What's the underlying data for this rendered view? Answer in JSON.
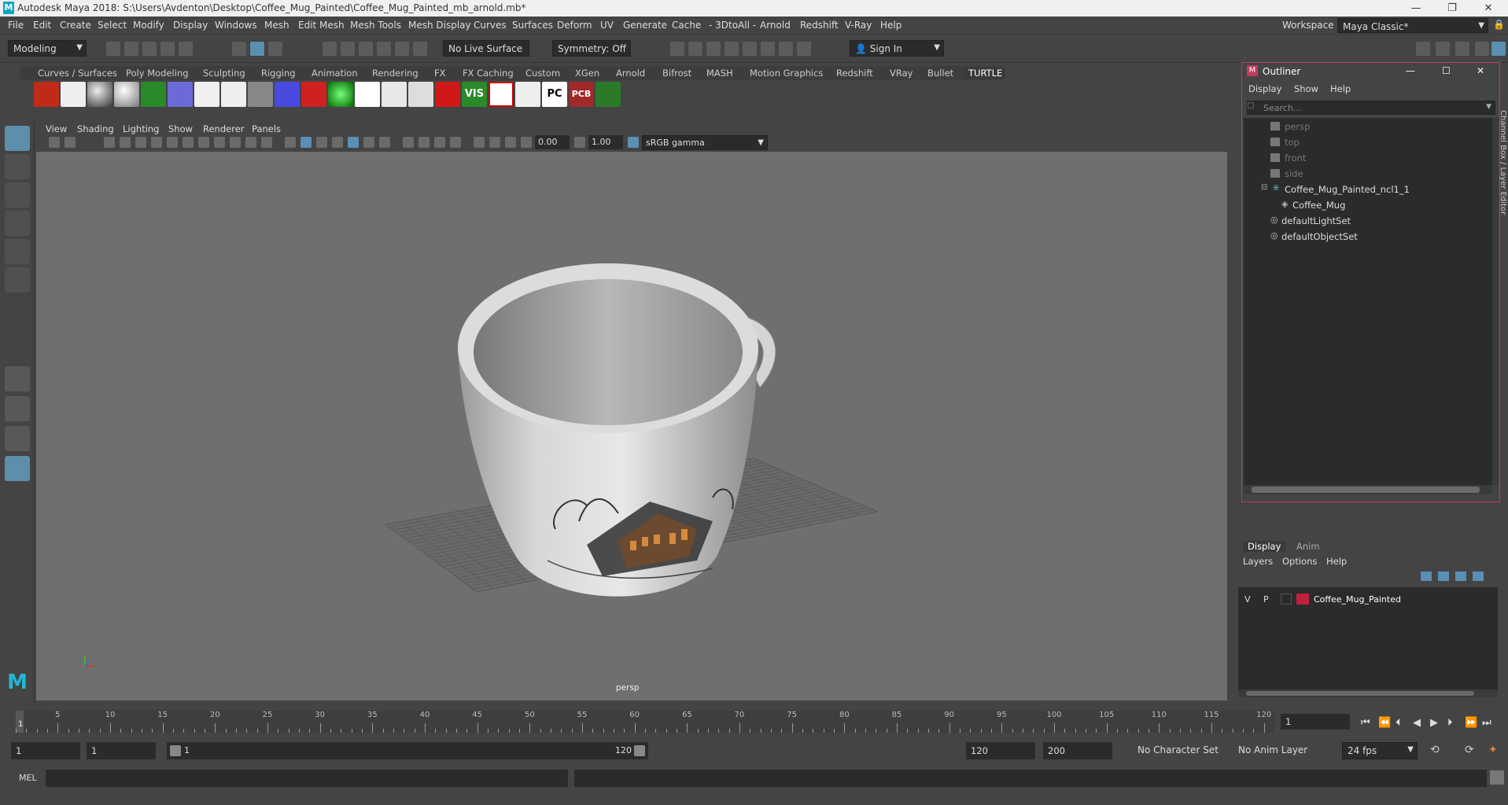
{
  "window": {
    "title": "Autodesk Maya 2018: S:\\Users\\Avdenton\\Desktop\\Coffee_Mug_Painted\\Coffee_Mug_Painted_mb_arnold.mb*",
    "minimize": "—",
    "restore": "❐",
    "close": "✕"
  },
  "menubar": [
    "File",
    "Edit",
    "Create",
    "Select",
    "Modify",
    "Display",
    "Windows",
    "Mesh",
    "Edit Mesh",
    "Mesh Tools",
    "Mesh Display",
    "Curves",
    "Surfaces",
    "Deform",
    "UV",
    "Generate",
    "Cache",
    "- 3DtoAll -",
    "Arnold",
    "Redshift",
    "V-Ray",
    "Help"
  ],
  "workspace": {
    "label": "Workspace :",
    "value": "Maya Classic*"
  },
  "statusline": {
    "mode": "Modeling",
    "live_surface": "No Live Surface",
    "symmetry": "Symmetry: Off",
    "sign_in": "Sign In"
  },
  "shelf": {
    "tabs": [
      "Curves / Surfaces",
      "Poly Modeling",
      "Sculpting",
      "Rigging",
      "Animation",
      "Rendering",
      "FX",
      "FX Caching",
      "Custom",
      "XGen",
      "Arnold",
      "Bifrost",
      "MASH",
      "Motion Graphics",
      "Redshift",
      "VRay",
      "Bullet",
      "TURTLE"
    ],
    "active_tab": "TURTLE",
    "icon_labels": [
      "VIS",
      "PC",
      "PCB"
    ]
  },
  "panel": {
    "menu": [
      "View",
      "Shading",
      "Lighting",
      "Show",
      "Renderer",
      "Panels"
    ],
    "gamma_value": "0.00",
    "exposure_value": "1.00",
    "color_space": "sRGB gamma",
    "camera_label": "persp"
  },
  "outliner": {
    "title": "Outliner",
    "menu": [
      "Display",
      "Show",
      "Help"
    ],
    "search_placeholder": "Search...",
    "items": [
      {
        "label": "persp",
        "dim": true
      },
      {
        "label": "top",
        "dim": true
      },
      {
        "label": "front",
        "dim": true
      },
      {
        "label": "side",
        "dim": true
      },
      {
        "label": "Coffee_Mug_Painted_ncl1_1",
        "dim": false
      },
      {
        "label": "Coffee_Mug",
        "dim": false
      },
      {
        "label": "defaultLightSet",
        "dim": false
      },
      {
        "label": "defaultObjectSet",
        "dim": false
      }
    ]
  },
  "side_tab": "Channel Box / Layer Editor",
  "layers": {
    "tabs": [
      "Display",
      "Anim"
    ],
    "menu": [
      "Layers",
      "Options",
      "Help"
    ],
    "row": {
      "v": "V",
      "p": "P",
      "name": "Coffee_Mug_Painted",
      "color": "#c0203c"
    }
  },
  "timeline": {
    "ticks": [
      "1",
      "5",
      "10",
      "15",
      "20",
      "25",
      "30",
      "35",
      "40",
      "45",
      "50",
      "55",
      "60",
      "65",
      "70",
      "75",
      "80",
      "85",
      "90",
      "95",
      "100",
      "105",
      "110",
      "115",
      "120"
    ],
    "current_frame": "1"
  },
  "range": {
    "start": "1",
    "anim_start": "1",
    "slider_start": "1",
    "slider_end": "120",
    "playback_end": "120",
    "anim_end": "200",
    "character_set": "No Character Set",
    "anim_layer": "No Anim Layer",
    "fps": "24 fps"
  },
  "commandline": {
    "label": "MEL"
  },
  "colors": {
    "accent": "#5d8eac",
    "outliner_border": "#c23a5a",
    "viewport": "#6f6f6f"
  }
}
